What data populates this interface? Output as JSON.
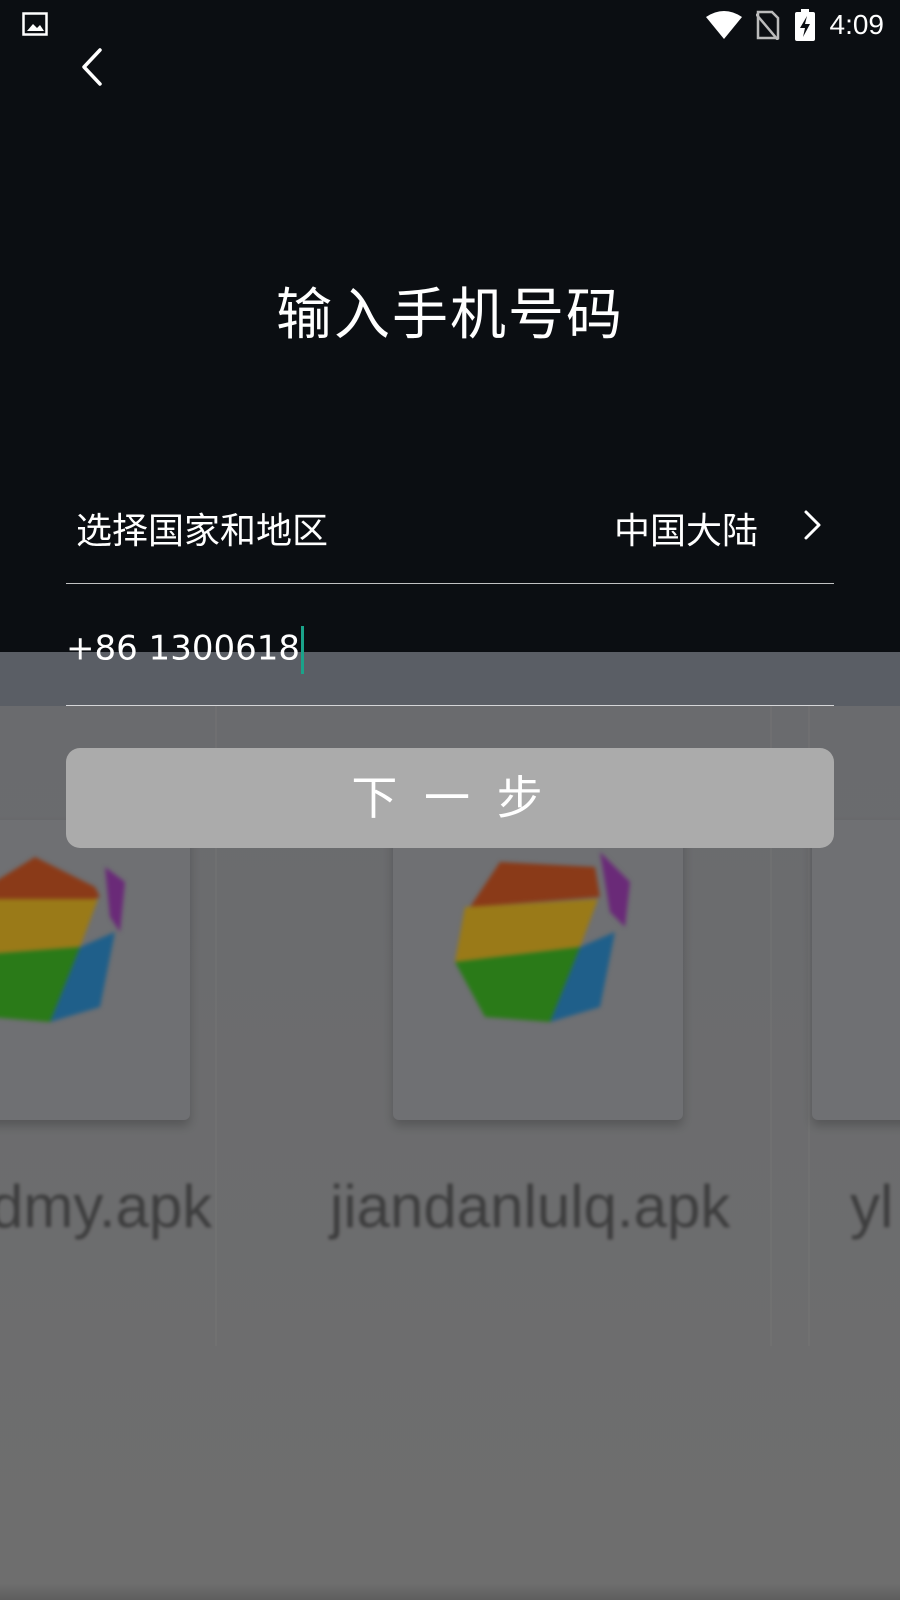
{
  "status_bar": {
    "time": "4:09",
    "icons": [
      "image-icon",
      "wifi-icon",
      "no-sim-icon",
      "battery-charging-icon"
    ]
  },
  "header": {
    "back_icon": "chevron-left-icon",
    "title": "输入手机号码"
  },
  "form": {
    "region_label": "选择国家和地区",
    "region_value": "中国大陆",
    "phone_value": "+86 1300618",
    "next_button_label": "下 一 步"
  },
  "background_files": [
    {
      "name": "dmy.apk"
    },
    {
      "name": "jiandanlulq.apk"
    },
    {
      "name": "yl"
    }
  ],
  "colors": {
    "page_bg": "#0b0e12",
    "button_bg": "#ababab",
    "cursor": "#1aa38a"
  }
}
